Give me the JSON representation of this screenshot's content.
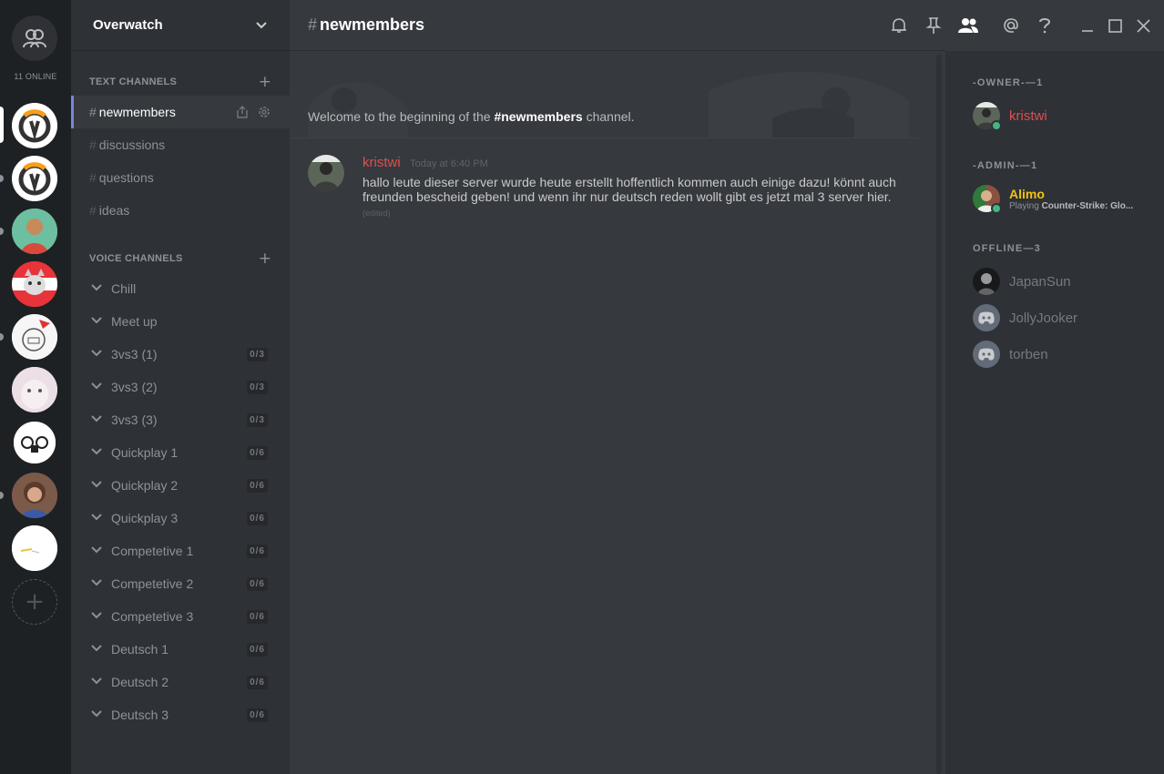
{
  "rail": {
    "online_label": "11 ONLINE",
    "servers": [
      {
        "name": "overwatch-server-1",
        "color": "#ffffff"
      },
      {
        "name": "overwatch-server-2",
        "color": "#ffffff"
      },
      {
        "name": "server-3",
        "color": "#7bc4a8"
      },
      {
        "name": "server-4",
        "color": "#e83e3e"
      },
      {
        "name": "server-5",
        "color": "#f4f4f4"
      },
      {
        "name": "server-6",
        "color": "#e8d8e0"
      },
      {
        "name": "server-7",
        "color": "#ffffff"
      },
      {
        "name": "server-8",
        "color": "#6a4a3a"
      },
      {
        "name": "server-9",
        "color": "#ffffff"
      }
    ],
    "add_label": "+"
  },
  "guild": {
    "name": "Overwatch"
  },
  "text_category": "TEXT CHANNELS",
  "text_channels": [
    {
      "label": "newmembers",
      "selected": true
    },
    {
      "label": "discussions"
    },
    {
      "label": "questions"
    },
    {
      "label": "ideas"
    }
  ],
  "voice_category": "VOICE CHANNELS",
  "voice_channels": [
    {
      "label": "Chill",
      "count": ""
    },
    {
      "label": "Meet up",
      "count": ""
    },
    {
      "label": "3vs3 (1)",
      "count": "0/3"
    },
    {
      "label": "3vs3 (2)",
      "count": "0/3"
    },
    {
      "label": "3vs3 (3)",
      "count": "0/3"
    },
    {
      "label": "Quickplay 1",
      "count": "0/6"
    },
    {
      "label": "Quickplay 2",
      "count": "0/6"
    },
    {
      "label": "Quickplay 3",
      "count": "0/6"
    },
    {
      "label": "Competetive 1",
      "count": "0/6"
    },
    {
      "label": "Competetive 2",
      "count": "0/6"
    },
    {
      "label": "Competetive 3",
      "count": "0/6"
    },
    {
      "label": "Deutsch 1",
      "count": "0/6"
    },
    {
      "label": "Deutsch 2",
      "count": "0/6"
    },
    {
      "label": "Deutsch 3",
      "count": "0/6"
    }
  ],
  "chat": {
    "channel": "newmembers",
    "welcome_prefix": "Welcome to the beginning of the ",
    "welcome_channel": "#newmembers",
    "welcome_suffix": " channel.",
    "message": {
      "author": "kristwi",
      "timestamp": "Today at 6:40 PM",
      "text": "hallo leute dieser server wurde heute erstellt hoffentlich kommen auch einige dazu! könnt auch freunden bescheid geben! und wenn ihr nur deutsch reden wollt gibt es jetzt mal 3 server hier.",
      "edited": "(edited)"
    }
  },
  "members": {
    "owner_header": "-OWNER-—1",
    "admin_header": "-ADMIN-—1",
    "offline_header": "OFFLINE—3",
    "owner": {
      "name": "kristwi"
    },
    "admin": {
      "name": "Alimo",
      "playing_prefix": "Playing ",
      "game": "Counter-Strike: Glo..."
    },
    "offline": [
      {
        "name": "JapanSun"
      },
      {
        "name": "JollyJooker"
      },
      {
        "name": "torben"
      }
    ]
  },
  "colors": {
    "accent": "#7289da",
    "owner": "#e04e4e",
    "admin": "#f1c40f",
    "online": "#43b581"
  }
}
